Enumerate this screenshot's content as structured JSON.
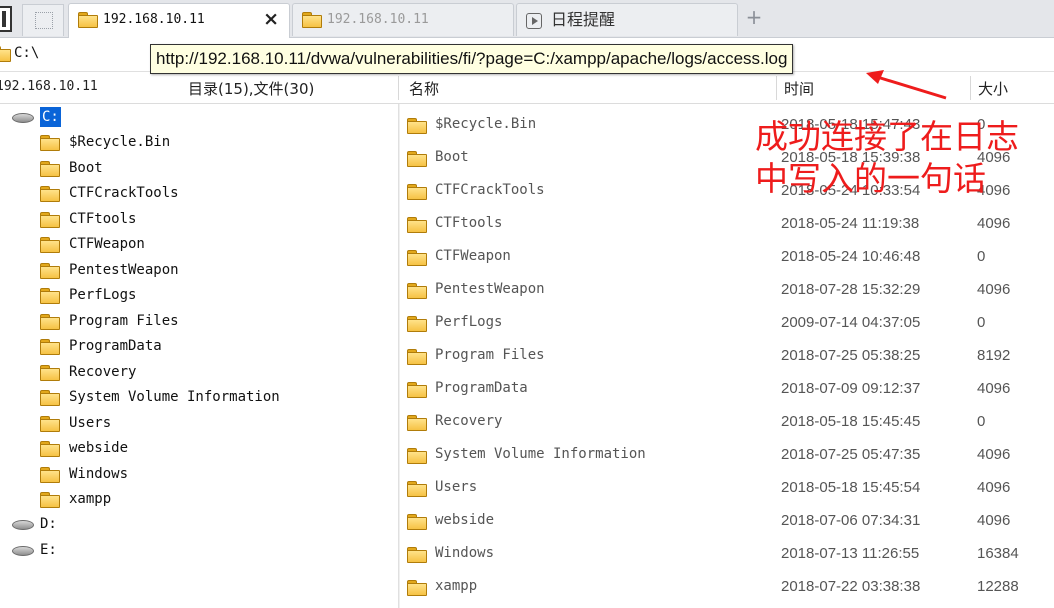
{
  "tabs": [
    {
      "label": "192.168.10.11",
      "active": true
    },
    {
      "label": "192.168.10.11",
      "active": false
    },
    {
      "label": "日程提醒",
      "active": false
    }
  ],
  "tab_close_glyph": "×",
  "tab_add_glyph": "+",
  "address": {
    "path": "C:\\"
  },
  "tooltip": {
    "url": "http://192.168.10.11/dvwa/vulnerabilities/fi/?page=C:/xampp/apache/logs/access.log"
  },
  "header": {
    "host": "192.168.10.11",
    "count_label": "目录(15),文件(30)",
    "col_name": "名称",
    "col_time": "时间",
    "col_size": "大小"
  },
  "tree": {
    "drives": [
      {
        "label": "C:",
        "selected": true
      },
      {
        "label": "D:",
        "selected": false
      },
      {
        "label": "E:",
        "selected": false
      }
    ],
    "folders": [
      "$Recycle.Bin",
      "Boot",
      "CTFCrackTools",
      "CTFtools",
      "CTFWeapon",
      "PentestWeapon",
      "PerfLogs",
      "Program Files",
      "ProgramData",
      "Recovery",
      "System Volume Information",
      "Users",
      "webside",
      "Windows",
      "xampp"
    ]
  },
  "files": [
    {
      "name": "$Recycle.Bin",
      "time": "2018-05-18 15:47:43",
      "size": "0"
    },
    {
      "name": "Boot",
      "time": "2018-05-18 15:39:38",
      "size": "4096"
    },
    {
      "name": "CTFCrackTools",
      "time": "2018-05-24 10:33:54",
      "size": "4096"
    },
    {
      "name": "CTFtools",
      "time": "2018-05-24 11:19:38",
      "size": "4096"
    },
    {
      "name": "CTFWeapon",
      "time": "2018-05-24 10:46:48",
      "size": "0"
    },
    {
      "name": "PentestWeapon",
      "time": "2018-07-28 15:32:29",
      "size": "4096"
    },
    {
      "name": "PerfLogs",
      "time": "2009-07-14 04:37:05",
      "size": "0"
    },
    {
      "name": "Program Files",
      "time": "2018-07-25 05:38:25",
      "size": "8192"
    },
    {
      "name": "ProgramData",
      "time": "2018-07-09 09:12:37",
      "size": "4096"
    },
    {
      "name": "Recovery",
      "time": "2018-05-18 15:45:45",
      "size": "0"
    },
    {
      "name": "System Volume Information",
      "time": "2018-07-25 05:47:35",
      "size": "4096"
    },
    {
      "name": "Users",
      "time": "2018-05-18 15:45:54",
      "size": "4096"
    },
    {
      "name": "webside",
      "time": "2018-07-06 07:34:31",
      "size": "4096"
    },
    {
      "name": "Windows",
      "time": "2018-07-13 11:26:55",
      "size": "16384"
    },
    {
      "name": "xampp",
      "time": "2018-07-22 03:38:38",
      "size": "12288"
    }
  ],
  "annotation": {
    "line1": "成功连接了在日志",
    "line2": "中写入的一句话"
  },
  "colors": {
    "accent_selection": "#0a64d8",
    "annotation_red": "#ee1c1c",
    "tooltip_bg": "#ffffe1",
    "folder_yellow": "#f6c244"
  },
  "icons": [
    "folder-icon",
    "drive-icon",
    "clock-icon",
    "close-icon",
    "add-tab-icon",
    "arrow-icon"
  ]
}
